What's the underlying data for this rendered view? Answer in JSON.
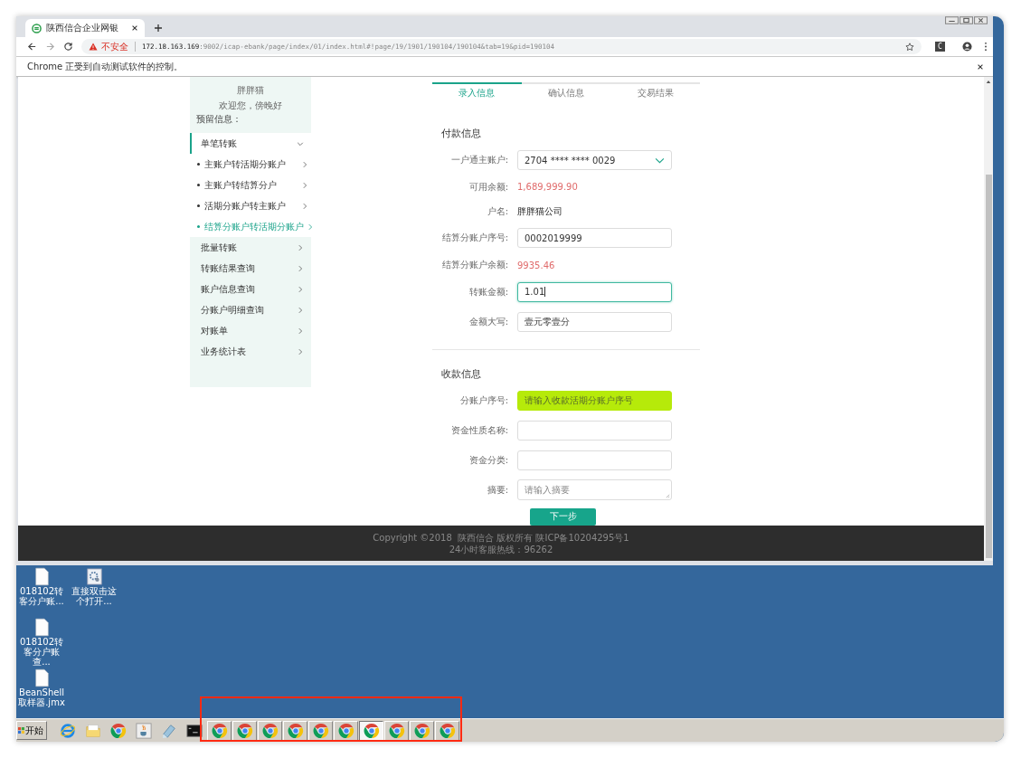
{
  "browser": {
    "tab": {
      "title": "陕西信合企业网银",
      "selected": true
    },
    "security": "不安全",
    "url_host": "172.18.163.169",
    "url_rest": ":9002/icap-ebank/page/index/01/index.html#!page/19/1901/190104/190104&tab=19&pid=190104",
    "extension_label": "C",
    "infobar": "Chrome 正受到自动测试软件的控制。"
  },
  "sidebar": {
    "user": "胖胖猫",
    "greeting": "欢迎您，傍晚好",
    "notice": "预留信息：",
    "menu": [
      {
        "label": "单笔转账",
        "selected": true,
        "expanded": true,
        "children": [
          {
            "label": "主账户转活期分账户",
            "selected": false
          },
          {
            "label": "主账户转结算分户",
            "selected": false
          },
          {
            "label": "活期分账户转主账户",
            "selected": false
          },
          {
            "label": "结算分账户转活期分账户",
            "selected": true
          }
        ]
      },
      {
        "label": "批量转账",
        "selected": false,
        "expanded": false
      },
      {
        "label": "转账结果查询",
        "selected": false,
        "expanded": false
      },
      {
        "label": "账户信息查询",
        "selected": false,
        "expanded": false
      },
      {
        "label": "分账户明细查询",
        "selected": false,
        "expanded": false
      },
      {
        "label": "对账单",
        "selected": false,
        "expanded": false
      },
      {
        "label": "业务统计表",
        "selected": false,
        "expanded": false
      }
    ]
  },
  "steps": [
    {
      "label": "录入信息",
      "selected": true
    },
    {
      "label": "确认信息",
      "selected": false
    },
    {
      "label": "交易结果",
      "selected": false
    }
  ],
  "sections": [
    {
      "title": "付款信息",
      "fields": [
        {
          "kind": "select",
          "label": "一户通主账户:",
          "value": "2704 **** **** 0029",
          "focused": false,
          "highlighted": false
        },
        {
          "kind": "amount",
          "label": "可用余额:",
          "value": "1,689,999.90"
        },
        {
          "kind": "text",
          "label": "户名:",
          "value": "胖胖猫公司"
        },
        {
          "kind": "input",
          "label": "结算分账户序号:",
          "value": "0002019999",
          "focused": false,
          "highlighted": false
        },
        {
          "kind": "amount",
          "label": "结算分账户余额:",
          "value": "9935.46"
        },
        {
          "kind": "input",
          "label": "转账金额:",
          "value": "1.01",
          "focused": true,
          "highlighted": false
        },
        {
          "kind": "input",
          "label": "金额大写:",
          "value": "壹元零壹分",
          "focused": false,
          "highlighted": false
        }
      ]
    },
    {
      "title": "收款信息",
      "fields": [
        {
          "kind": "input",
          "label": "分账户序号:",
          "placeholder": "请输入收款活期分账户序号",
          "focused": false,
          "highlighted": true
        },
        {
          "kind": "input",
          "label": "资金性质名称:",
          "focused": false,
          "highlighted": false
        },
        {
          "kind": "input",
          "label": "资金分类:",
          "focused": false,
          "highlighted": false
        },
        {
          "kind": "textarea",
          "label": "摘要:",
          "placeholder": "请输入摘要",
          "focused": false,
          "highlighted": false
        }
      ]
    }
  ],
  "next_button": "下一步",
  "footer": [
    "Copyright ©2018  陕西信合 版权所有 陕ICP备10204295号1",
    "24小时客服热线：96262"
  ],
  "desktop_icons": [
    {
      "kind": "file",
      "label": "018102转客分户账..."
    },
    {
      "kind": "settings",
      "label": "直接双击这个打开..."
    },
    {
      "kind": "file",
      "label": "018102转客分户账查..."
    },
    {
      "kind": "file",
      "label": "BeanShell 取样器.jmx"
    }
  ],
  "taskbar": {
    "start": "开始",
    "items": [
      {
        "kind": "ie",
        "selected": false
      },
      {
        "kind": "folder",
        "selected": false
      },
      {
        "kind": "chrome",
        "selected": false
      },
      {
        "kind": "java",
        "selected": false
      },
      {
        "kind": "notepad",
        "selected": false
      },
      {
        "kind": "cmd",
        "selected": false
      },
      {
        "kind": "chrome",
        "selected": false
      },
      {
        "kind": "chrome",
        "selected": false
      },
      {
        "kind": "chrome",
        "selected": false
      },
      {
        "kind": "chrome",
        "selected": false
      },
      {
        "kind": "chrome",
        "selected": false
      },
      {
        "kind": "chrome",
        "selected": false
      },
      {
        "kind": "chrome",
        "selected": true
      },
      {
        "kind": "chrome",
        "selected": false
      },
      {
        "kind": "chrome",
        "selected": false
      },
      {
        "kind": "chrome",
        "selected": false
      }
    ]
  }
}
